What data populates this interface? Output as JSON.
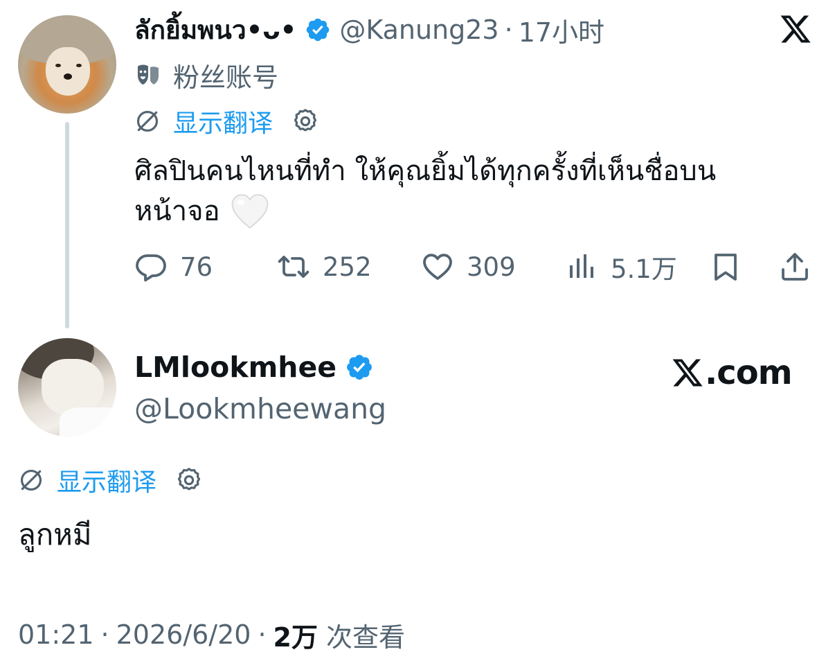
{
  "parent_tweet": {
    "display_name": "ลักยิ้มพนว•ᴗ•",
    "handle": "@Kanung23",
    "separator": "·",
    "time_ago": "17小时",
    "account_label": "粉丝账号",
    "translate_label": "显示翻译",
    "text_line1": "ศิลปินคนไหนที่ทำ ให้คุณยิ้มได้ทุกครั้งที่เห็นชื่อบน",
    "text_line2": "หน้าจอ",
    "stats": {
      "replies": "76",
      "retweets": "252",
      "likes": "309",
      "views": "5.1万"
    }
  },
  "main_tweet": {
    "display_name": "LMlookmhee",
    "handle": "@Lookmheewang",
    "brand_suffix": ".com",
    "translate_label": "显示翻译",
    "text": "ลูกหมี",
    "time": "01:21",
    "separator1": "·",
    "date": "2026/6/20",
    "separator2": "·",
    "views_count": "2万",
    "views_label": "次查看"
  },
  "colors": {
    "text_primary": "#0f1419",
    "text_secondary": "#536471",
    "link_blue": "#1d9bf0",
    "verified_blue": "#1d9bf0",
    "thread_line": "#cfd9de"
  },
  "icons": {
    "verified": "verified-badge-icon",
    "x_logo": "x-logo-icon",
    "account_label": "mask-icon",
    "translate": "translate-icon",
    "settings": "gear-icon",
    "reply": "reply-icon",
    "retweet": "retweet-icon",
    "like": "heart-icon",
    "views": "views-chart-icon",
    "bookmark": "bookmark-icon",
    "share": "share-icon"
  }
}
